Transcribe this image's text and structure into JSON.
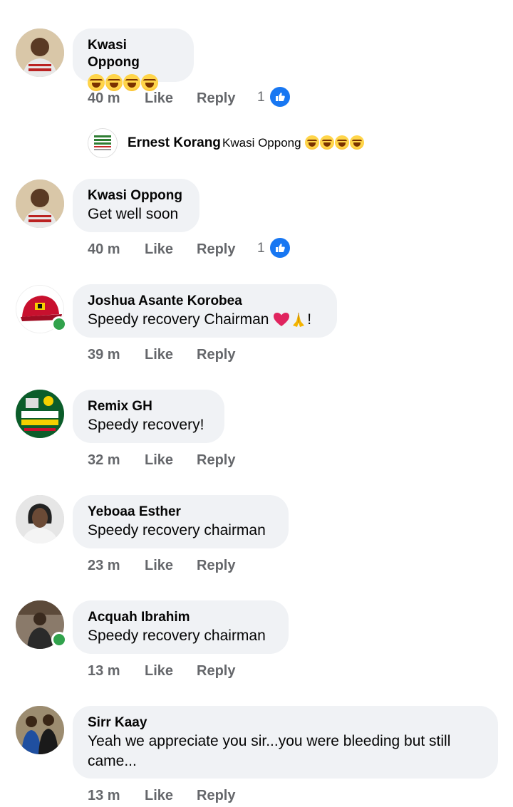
{
  "comments": [
    {
      "author": "Kwasi Oppong",
      "text": "",
      "emojis": [
        "laughing-crying-emoji",
        "laughing-crying-emoji",
        "rofl-emoji",
        "rofl-emoji"
      ],
      "time": "40 m",
      "like": "Like",
      "reply": "Reply",
      "like_count": "1",
      "online": false
    },
    {
      "author": "Kwasi Oppong",
      "text": "Get well soon",
      "time": "40 m",
      "like": "Like",
      "reply": "Reply",
      "like_count": "1",
      "online": false
    },
    {
      "author": "Joshua Asante Korobea",
      "text": "Speedy recovery Chairman",
      "text_suffix": "!",
      "emojis": [
        "heart-emoji",
        "praying-hands-emoji"
      ],
      "time": "39 m",
      "like": "Like",
      "reply": "Reply",
      "online": true
    },
    {
      "author": "Remix GH",
      "text": "Speedy recovery!",
      "time": "32 m",
      "like": "Like",
      "reply": "Reply",
      "online": false
    },
    {
      "author": "Yeboaa Esther",
      "text": "Speedy recovery chairman",
      "time": "23 m",
      "like": "Like",
      "reply": "Reply",
      "online": false
    },
    {
      "author": "Acquah Ibrahim",
      "text": "Speedy recovery chairman",
      "time": "13 m",
      "like": "Like",
      "reply": "Reply",
      "online": true
    },
    {
      "author": "Sirr Kaay",
      "text": "Yeah we appreciate you sir...you were bleeding but still came...",
      "time": "13 m",
      "like": "Like",
      "reply": "Reply",
      "online": false
    }
  ],
  "reply_preview": {
    "author": "Ernest Korang",
    "mention": "Kwasi Oppong",
    "emojis": [
      "rofl-emoji",
      "rofl-emoji",
      "rofl-emoji",
      "rofl-emoji"
    ]
  },
  "colors": {
    "bubble": "#f0f2f5",
    "meta": "#65676b",
    "like_blue": "#1877f2",
    "online_green": "#31a24c"
  }
}
